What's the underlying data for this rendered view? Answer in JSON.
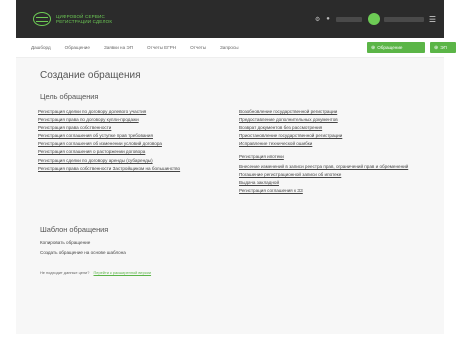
{
  "header": {
    "logo_line1": "Цифровой сервис",
    "logo_line2": "регистрации сделок"
  },
  "nav": {
    "items": [
      "Дашборд",
      "Обращение",
      "Заявки на ЭП",
      "Отчеты ЕГРН",
      "Отчеты",
      "Запросы"
    ],
    "request_button": "Обращение",
    "ep_button": "ЭП"
  },
  "main": {
    "title": "Создание обращения",
    "purpose_heading": "Цель обращения",
    "left_links": [
      "Регистрация сделки по договору долевого участия",
      "Регистрация права по договору купли-продажи",
      "Регистрация права собственности",
      "Регистрация соглашения об уступке прав требования",
      "Регистрация соглашения об изменении условий договора",
      "Регистрация соглашения о расторжении договора",
      "Регистрация сделки по договору аренды (субаренды)",
      "Регистрация права собственности Застройщиком на большинство"
    ],
    "right_links_group1": [
      "Возобновление государственной регистрации",
      "Предоставление дополнительных документов",
      "Возврат документов без рассмотрения",
      "Приостановление государственной регистрации",
      "Исправление технической ошибки"
    ],
    "right_links_group2": [
      "Регистрация ипотеки",
      "Внесение изменений в записи реестра прав, ограничений прав и обременений",
      "Погашение регистрационной записи об ипотеке",
      "Выдача закладной",
      "Регистрация соглашения к ЗЗ"
    ],
    "template_heading": "Шаблон обращения",
    "template_copy": "Копировать обращение",
    "template_create": "Создать обращение на основе шаблона",
    "note_text": "Не подходит данные цели?",
    "note_link": "Перейти к расширенной версии"
  }
}
